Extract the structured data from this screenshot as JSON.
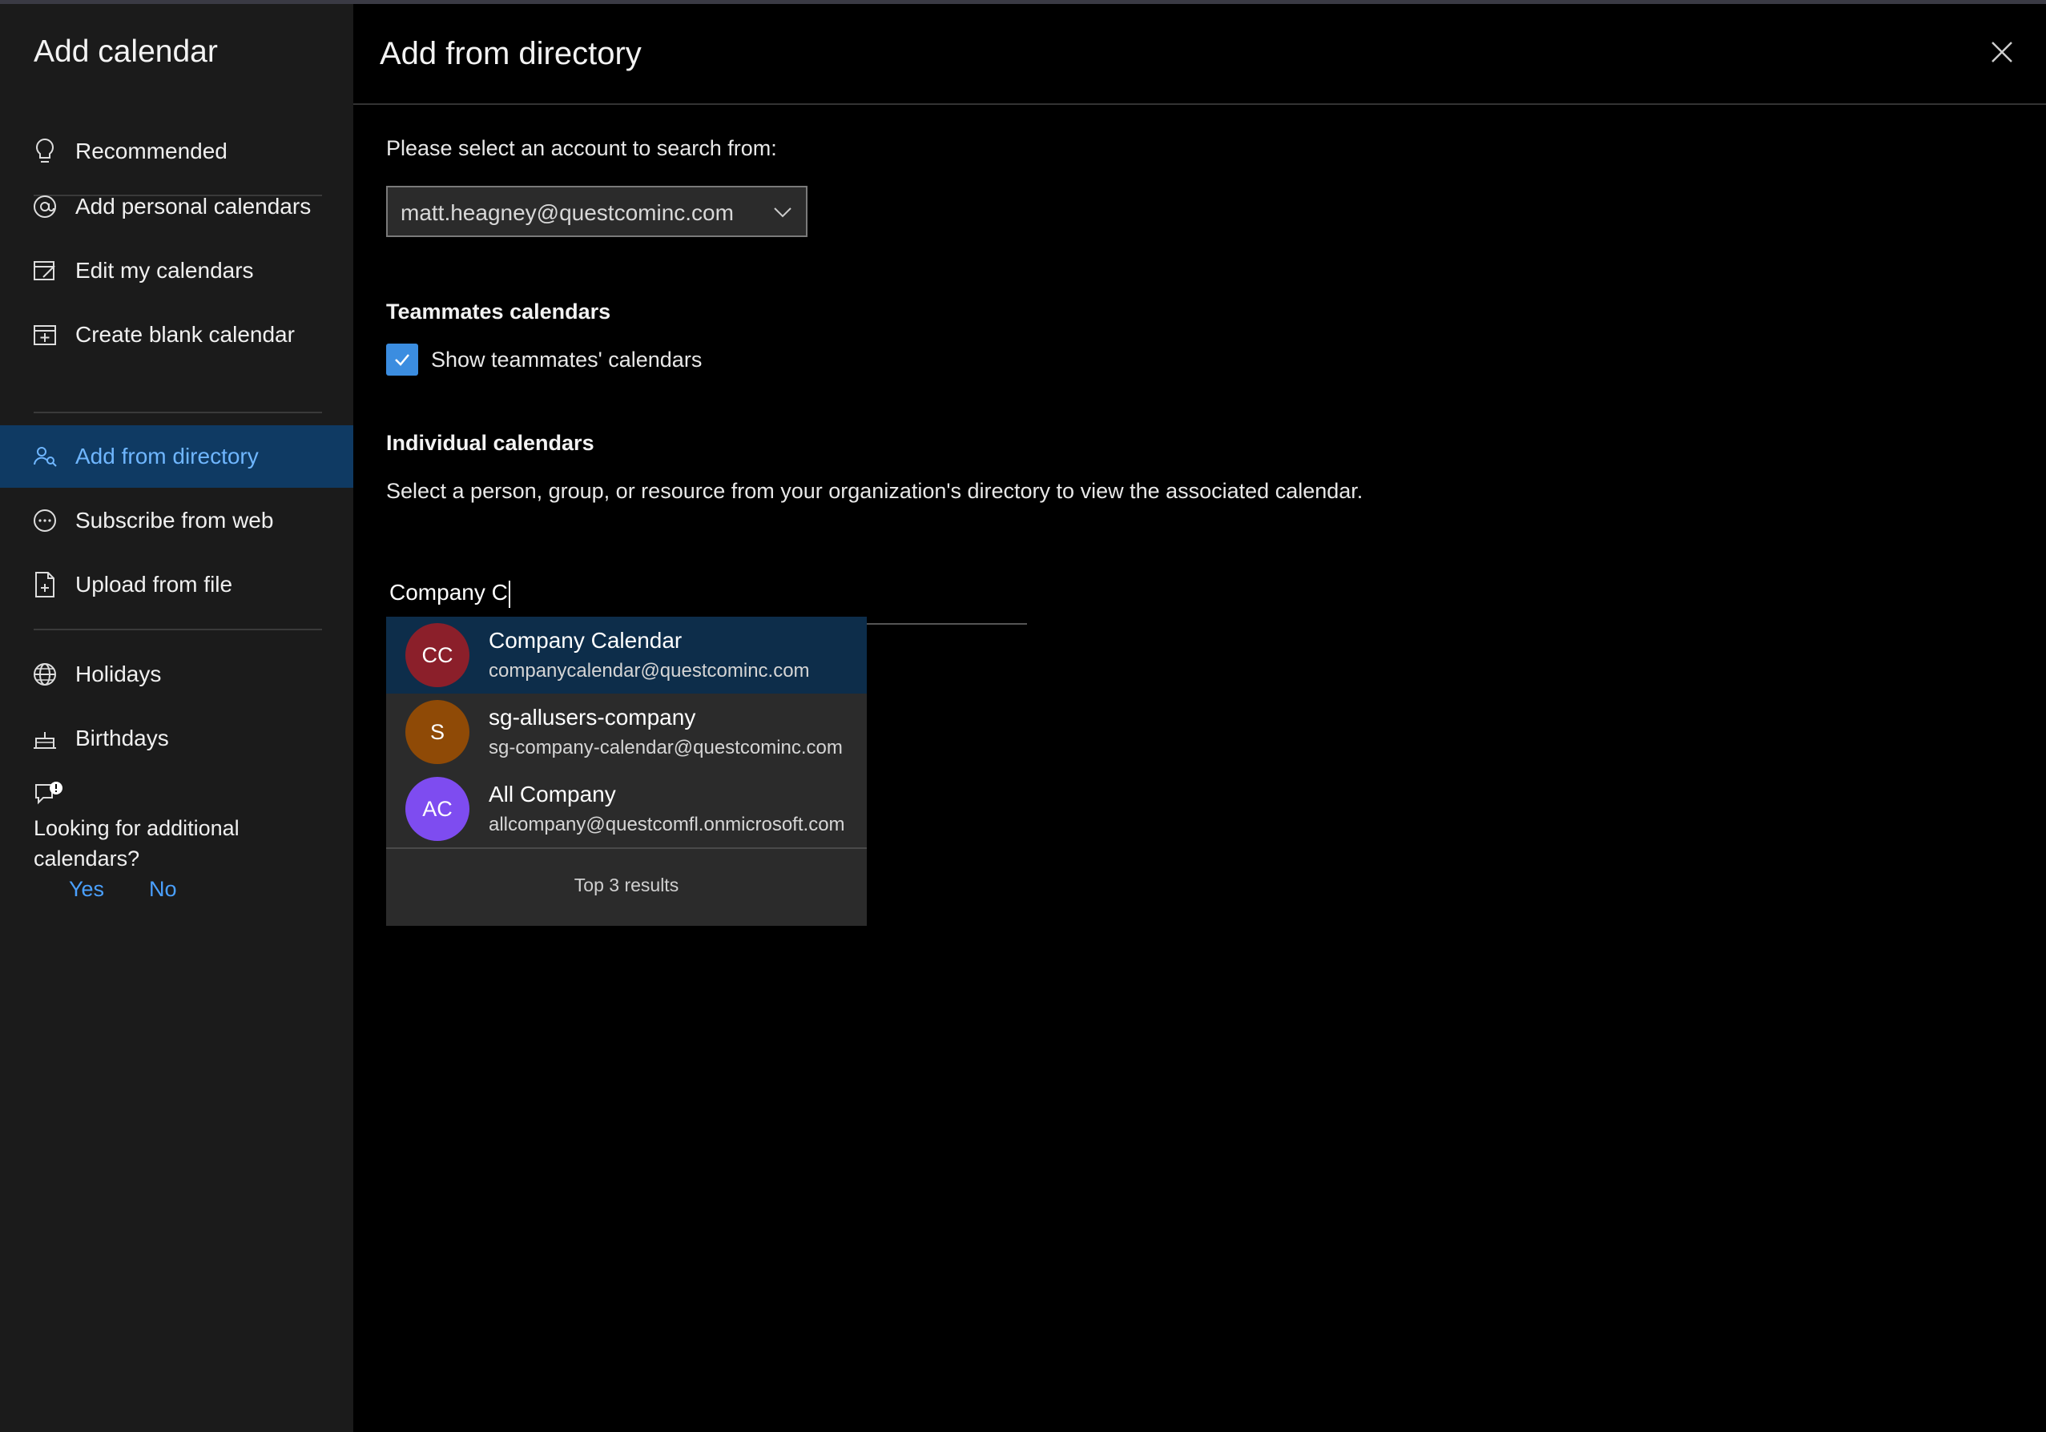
{
  "sidebar": {
    "title": "Add calendar",
    "items": [
      {
        "label": "Recommended",
        "icon": "lightbulb-icon"
      },
      {
        "label": "Add personal calendars",
        "icon": "at-sign-icon"
      },
      {
        "label": "Edit my calendars",
        "icon": "edit-calendar-icon"
      },
      {
        "label": "Create blank calendar",
        "icon": "calendar-add-icon"
      },
      {
        "label": "Add from directory",
        "icon": "people-search-icon",
        "active": true
      },
      {
        "label": "Subscribe from web",
        "icon": "web-link-icon"
      },
      {
        "label": "Upload from file",
        "icon": "file-upload-icon"
      },
      {
        "label": "Holidays",
        "icon": "globe-icon"
      },
      {
        "label": "Birthdays",
        "icon": "cake-icon"
      }
    ],
    "feedback": {
      "question": "Looking for additional calendars?",
      "yes": "Yes",
      "no": "No"
    }
  },
  "main": {
    "title": "Add from directory",
    "account_prompt": "Please select an account to search from:",
    "account_value": "matt.heagney@questcominc.com",
    "teammates": {
      "heading": "Teammates calendars",
      "checkbox_label": "Show teammates' calendars",
      "checked": true
    },
    "individual": {
      "heading": "Individual calendars",
      "description": "Select a person, group, or resource from your organization's directory to view the associated calendar."
    },
    "search_value": "Company C",
    "results": [
      {
        "initials": "CC",
        "name": "Company Calendar",
        "email": "companycalendar@questcominc.com",
        "color": "#8b1f2a"
      },
      {
        "initials": "S",
        "name": "sg-allusers-company",
        "email": "sg-company-calendar@questcominc.com",
        "color": "#8f4a06"
      },
      {
        "initials": "AC",
        "name": "All Company",
        "email": "allcompany@questcomfl.onmicrosoft.com",
        "color": "#7e4cf0"
      }
    ],
    "results_footer": "Top 3 results"
  },
  "colors": {
    "accent": "#3b8de0",
    "link": "#4aa0ff",
    "active_nav_bg": "#0f3a63"
  }
}
